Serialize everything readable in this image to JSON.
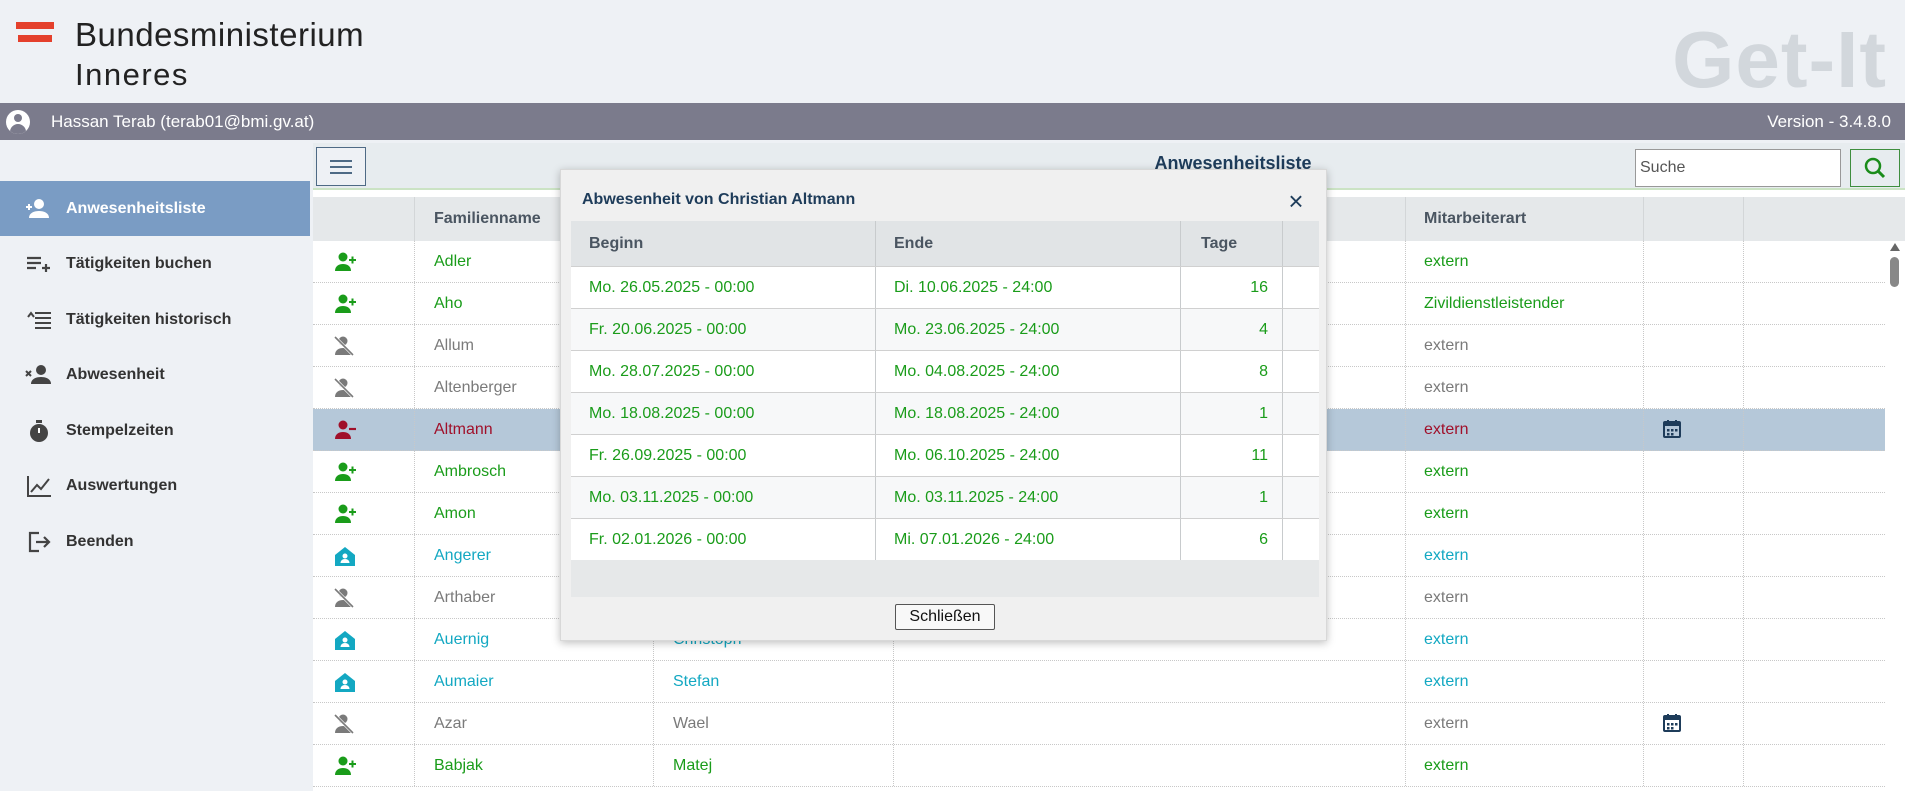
{
  "header": {
    "org_line1": "Bundesministerium",
    "org_line2": "Inneres",
    "brand": "Get-It",
    "flag_color": "#e4402c"
  },
  "userbar": {
    "user": "Hassan Terab (terab01@bmi.gv.at)",
    "version": "Version - 3.4.8.0"
  },
  "sidebar": {
    "items": [
      {
        "label": "Anwesenheitsliste",
        "icon": "person-add-icon",
        "active": true
      },
      {
        "label": "Tätigkeiten buchen",
        "icon": "playlist-add-icon",
        "active": false
      },
      {
        "label": "Tätigkeiten historisch",
        "icon": "list-history-icon",
        "active": false
      },
      {
        "label": "Abwesenheit",
        "icon": "person-remove-icon",
        "active": false
      },
      {
        "label": "Stempelzeiten",
        "icon": "stopwatch-icon",
        "active": false
      },
      {
        "label": "Auswertungen",
        "icon": "line-chart-icon",
        "active": false
      },
      {
        "label": "Beenden",
        "icon": "logout-icon",
        "active": false
      }
    ]
  },
  "toolbar": {
    "title": "Anwesenheitsliste",
    "search_placeholder": "Suche"
  },
  "table": {
    "columns": [
      "Familienname",
      "Mitarbeiterart"
    ],
    "rows": [
      {
        "status": "present",
        "family": "Adler",
        "first": "",
        "type": "extern",
        "calendar": false
      },
      {
        "status": "present",
        "family": "Aho",
        "first": "",
        "type": "Zivildienstleistender",
        "calendar": false
      },
      {
        "status": "off",
        "family": "Allum",
        "first": "",
        "type": "extern",
        "calendar": false
      },
      {
        "status": "off",
        "family": "Altenberger",
        "first": "",
        "type": "extern",
        "calendar": false
      },
      {
        "status": "absent",
        "family": "Altmann",
        "first": "",
        "type": "extern",
        "calendar": true,
        "selected": true
      },
      {
        "status": "present",
        "family": "Ambrosch",
        "first": "",
        "type": "extern",
        "calendar": false
      },
      {
        "status": "present",
        "family": "Amon",
        "first": "",
        "type": "extern",
        "calendar": false
      },
      {
        "status": "home",
        "family": "Angerer",
        "first": "",
        "type": "extern",
        "calendar": false
      },
      {
        "status": "off",
        "family": "Arthaber",
        "first": "",
        "type": "extern",
        "calendar": false
      },
      {
        "status": "home",
        "family": "Auernig",
        "first": "Christoph",
        "type": "extern",
        "calendar": false
      },
      {
        "status": "home",
        "family": "Aumaier",
        "first": "Stefan",
        "type": "extern",
        "calendar": false
      },
      {
        "status": "off",
        "family": "Azar",
        "first": "Wael",
        "type": "extern",
        "calendar": true
      },
      {
        "status": "present",
        "family": "Babjak",
        "first": "Matej",
        "type": "extern",
        "calendar": false
      }
    ]
  },
  "dialog": {
    "title": "Abwesenheit von Christian Altmann",
    "columns": [
      "Beginn",
      "Ende",
      "Tage"
    ],
    "rows": [
      {
        "begin": "Mo. 26.05.2025 - 00:00",
        "end": "Di. 10.06.2025 - 24:00",
        "days": "16"
      },
      {
        "begin": "Fr. 20.06.2025 - 00:00",
        "end": "Mo. 23.06.2025 - 24:00",
        "days": "4"
      },
      {
        "begin": "Mo. 28.07.2025 - 00:00",
        "end": "Mo. 04.08.2025 - 24:00",
        "days": "8"
      },
      {
        "begin": "Mo. 18.08.2025 - 00:00",
        "end": "Mo. 18.08.2025 - 24:00",
        "days": "1"
      },
      {
        "begin": "Fr. 26.09.2025 - 00:00",
        "end": "Mo. 06.10.2025 - 24:00",
        "days": "11"
      },
      {
        "begin": "Mo. 03.11.2025 - 00:00",
        "end": "Mo. 03.11.2025 - 24:00",
        "days": "1"
      },
      {
        "begin": "Fr. 02.01.2026 - 00:00",
        "end": "Mi. 07.01.2026 - 24:00",
        "days": "6"
      }
    ],
    "close_button": "Schließen"
  },
  "colors": {
    "present": "#1a9c1a",
    "off": "#7a7a7a",
    "absent": "#a0102a",
    "home": "#13a8c2",
    "active_nav": "#7a9cc4",
    "userbar": "#7b7b8c"
  }
}
